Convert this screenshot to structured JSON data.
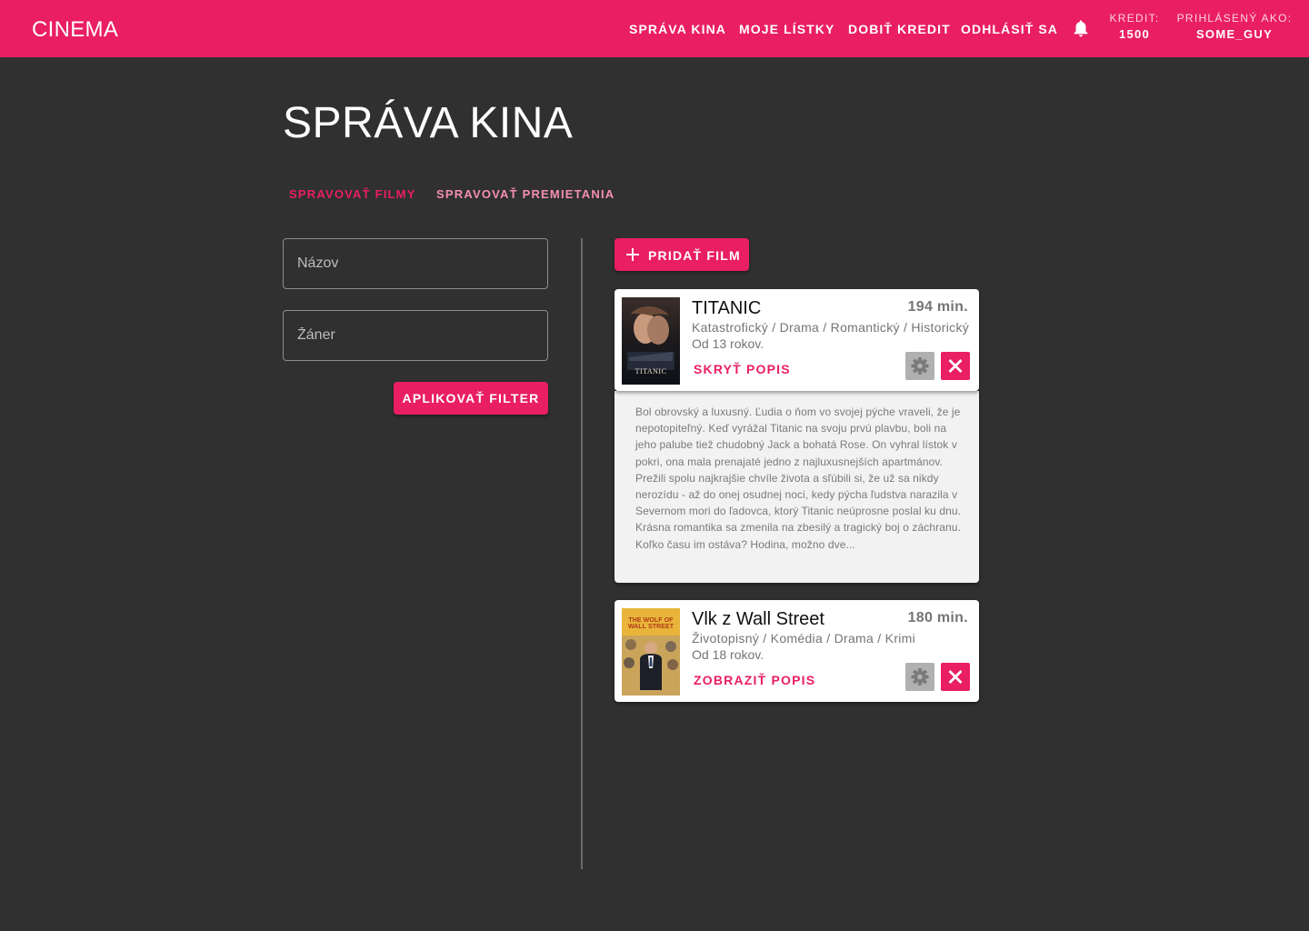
{
  "header": {
    "brand": "CINEMA",
    "nav": {
      "manage_cinema": "SPRÁVA KINA",
      "my_tickets": "MOJE LÍSTKY",
      "top_up": "DOBIŤ KREDIT",
      "logout": "ODHLÁSIŤ SA"
    },
    "notifications_icon": "bell-icon",
    "credit_label": "KREDIT:",
    "credit_value": "1500",
    "user_label": "PRIHLÁSENÝ AKO:",
    "user_value": "SOME_GUY"
  },
  "page": {
    "title": "SPRÁVA KINA",
    "tabs": [
      {
        "label": "SPRAVOVAŤ FILMY",
        "active": true
      },
      {
        "label": "SPRAVOVAŤ PREMIETANIA",
        "active": false
      }
    ]
  },
  "filter": {
    "name_placeholder": "Názov",
    "name_value": "",
    "genre_placeholder": "Žáner",
    "genre_value": "",
    "apply_label": "APLIKOVAŤ FILTER"
  },
  "movies_panel": {
    "add_label": "PRIDAŤ FILM",
    "add_icon": "plus-icon",
    "movies": [
      {
        "title": "TITANIC",
        "length": "194 min.",
        "genres": "Katastrofický / Drama / Romantický / Historický",
        "age": "Od 13 rokov.",
        "toggle": "SKRYŤ POPIS",
        "poster_caption": "TITANIC",
        "expanded": true,
        "description": "Bol obrovský a luxusný. Ľudia o ňom vo svojej pýche vraveli, že je nepotopiteľný. Keď vyrážal Titanic na svoju prvú plavbu, boli na jeho palube tiež chudobný Jack a bohatá Rose. On vyhral lístok v pokri, ona mala prenajaté jedno z najluxusnejších apartmánov. Prežili spolu najkrajšie chvíle života a sľúbili si, že už sa nikdy nerozídu - až do onej osudnej noci, kedy pýcha ľudstva narazila v Severnom mori do ľadovca, ktorý Titanic neúprosne poslal ku dnu. Krásna romantika sa zmenila na zbesilý a tragický boj o záchranu. Koľko času im ostáva? Hodina, možno dve..."
      },
      {
        "title": "Vlk z Wall Street",
        "length": "180 min.",
        "genres": "Životopisný / Komédia / Drama / Krimi",
        "age": "Od 18 rokov.",
        "toggle": "ZOBRAZIŤ POPIS",
        "poster_caption": "THE WOLF OF WALL STREET",
        "expanded": false
      }
    ]
  },
  "colors": {
    "accent": "#e91e63",
    "background": "#303030",
    "card": "#ffffff",
    "description_bg": "#f2f2f2"
  }
}
